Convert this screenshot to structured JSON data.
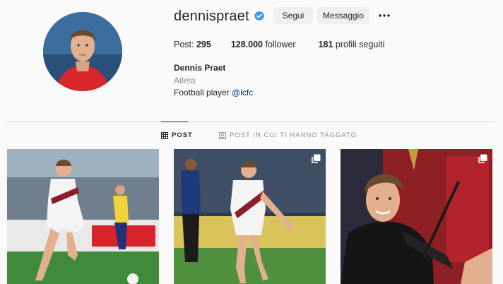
{
  "profile": {
    "username": "dennispraet",
    "follow_label": "Segui",
    "message_label": "Messaggio",
    "stats": {
      "posts_label": "Post: ",
      "posts_value": "295",
      "followers_value": "128.000",
      "followers_label": " follower",
      "following_value": "181",
      "following_label": " profili seguiti"
    },
    "full_name": "Dennis Praet",
    "category": "Atleta",
    "bio_text": "Football player ",
    "bio_link": "@lcfc"
  },
  "tabs": [
    {
      "label": "POST",
      "icon": "grid-icon",
      "active": true
    },
    {
      "label": "POST IN CUI TI HANNO TAGGATO",
      "icon": "tag-icon",
      "active": false
    }
  ],
  "posts": [
    {
      "icon": "",
      "multi": false
    },
    {
      "icon": "multiple-images-icon",
      "multi": true
    },
    {
      "icon": "multiple-images-icon",
      "multi": true
    }
  ],
  "colors": {
    "background": "#fafafa",
    "button_bg": "#efefef",
    "verified": "#3897f0",
    "link": "#00376b",
    "muted": "#8e8e8e",
    "divider": "#dbdbdb"
  }
}
